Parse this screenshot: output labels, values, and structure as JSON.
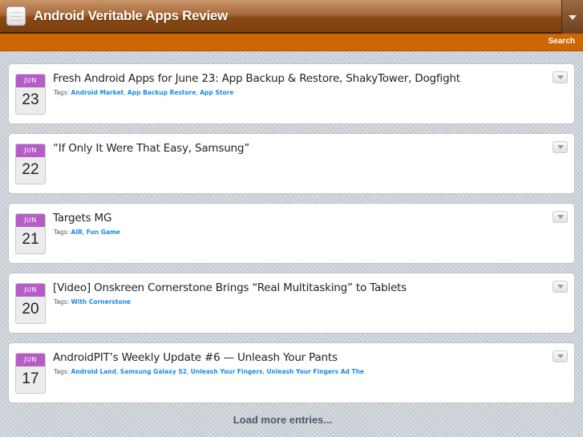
{
  "header": {
    "title": "Android Veritable Apps Review",
    "search_label": "Search"
  },
  "posts": [
    {
      "month": "JUN",
      "day": "23",
      "title": "Fresh Android Apps for June 23: App Backup & Restore, ShakyTower, Dogfight",
      "tags_label": "Tags:",
      "tags": [
        "Android Market",
        "App Backup Restore",
        "App Store"
      ]
    },
    {
      "month": "JUN",
      "day": "22",
      "title": "“If Only It Were That Easy, Samsung”",
      "tags_label": "",
      "tags": []
    },
    {
      "month": "JUN",
      "day": "21",
      "title": "Targets MG",
      "tags_label": "Tags:",
      "tags": [
        "AIR",
        "Fun Game"
      ]
    },
    {
      "month": "JUN",
      "day": "20",
      "title": "[Video] Onskreen Cornerstone Brings “Real Multitasking” to Tablets",
      "tags_label": "Tags:",
      "tags": [
        "With Cornerstone"
      ]
    },
    {
      "month": "JUN",
      "day": "17",
      "title": "AndroidPIT’s Weekly Update #6 — Unleash Your Pants",
      "tags_label": "Tags:",
      "tags": [
        "Android Land",
        "Samsung Galaxy S2",
        "Unleash Your Fingers",
        "Unleash Your Fingers Ad The"
      ]
    }
  ],
  "load_more": "Load more entries..."
}
